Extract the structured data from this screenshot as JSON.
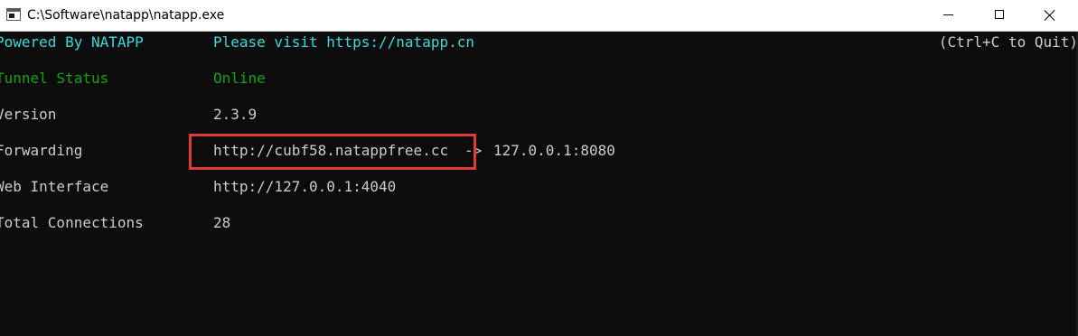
{
  "window": {
    "title": "C:\\Software\\natapp\\natapp.exe"
  },
  "console": {
    "powered_by": "Powered By NATAPP",
    "visit": "Please visit https://natapp.cn",
    "quit_hint": "(Ctrl+C to Quit)",
    "rows": [
      {
        "label": "Tunnel Status",
        "value": "Online"
      },
      {
        "label": "Version",
        "value": "2.3.9"
      },
      {
        "label": "Forwarding",
        "value": "http://cubf58.natappfree.cc",
        "arrow": "->",
        "target": "127.0.0.1:8080"
      },
      {
        "label": "Web Interface",
        "value": "http://127.0.0.1:4040"
      },
      {
        "label": "Total Connections",
        "value": "28"
      }
    ]
  },
  "colors": {
    "header_cyan": "#3ad9d9",
    "status_green": "#13a10e",
    "highlight_red": "#e53935"
  },
  "icons": {
    "app": "console-window-icon",
    "minimize": "minimize-icon",
    "maximize": "maximize-icon",
    "close": "close-icon"
  }
}
